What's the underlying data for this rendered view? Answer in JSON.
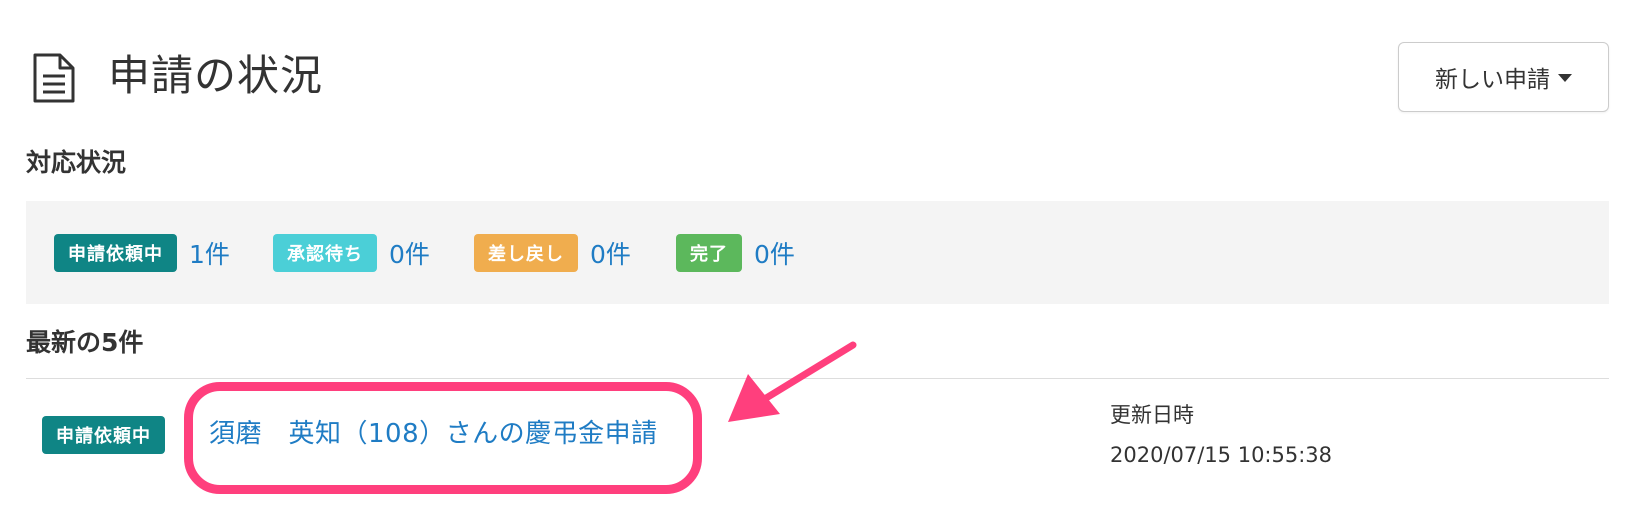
{
  "header": {
    "title": "申請の状況",
    "icon": "document-icon",
    "new_button": {
      "label": "新しい申請",
      "icon": "caret-down-icon"
    }
  },
  "status_section": {
    "heading": "対応状況",
    "items": [
      {
        "badge": "申請依頼中",
        "count": "1件",
        "color": "#0f8585"
      },
      {
        "badge": "承認待ち",
        "count": "0件",
        "color": "#4bcfd7"
      },
      {
        "badge": "差し戻し",
        "count": "0件",
        "color": "#f0ad4e"
      },
      {
        "badge": "完了",
        "count": "0件",
        "color": "#5cb85c"
      }
    ]
  },
  "latest_section": {
    "heading": "最新の5件",
    "rows": [
      {
        "badge": "申請依頼中",
        "title": "須磨　英知（108）さんの慶弔金申請",
        "updated_label": "更新日時",
        "updated_value": "2020/07/15 10:55:38"
      }
    ]
  },
  "annotation": {
    "highlight_color": "#ff3f7d"
  }
}
